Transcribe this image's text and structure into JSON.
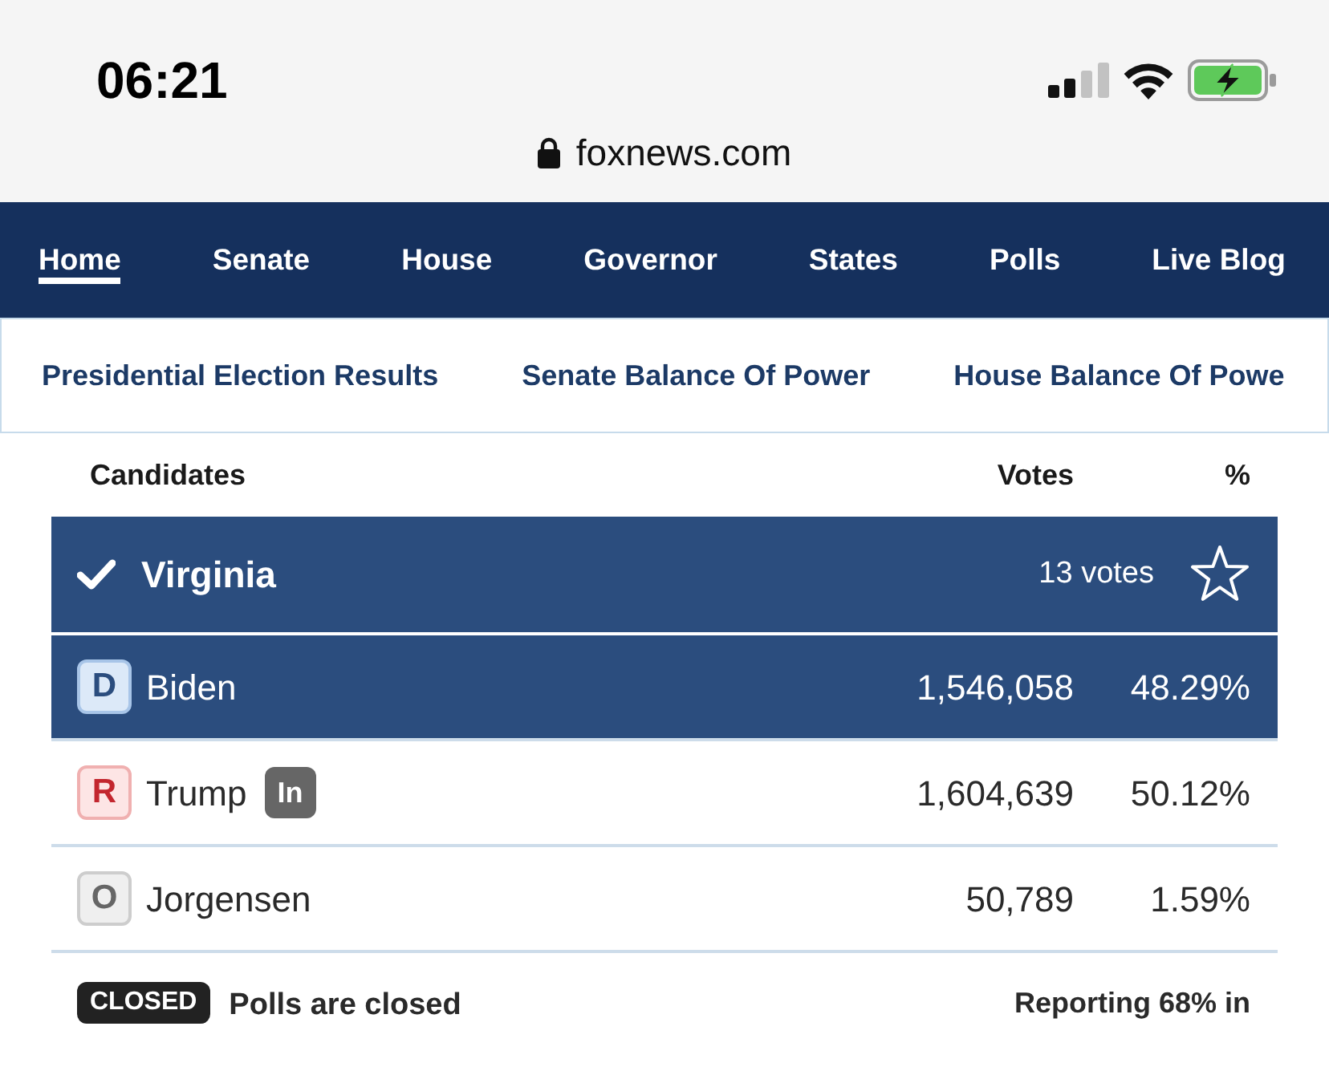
{
  "status_bar": {
    "time": "06:21"
  },
  "address_bar": {
    "url": "foxnews.com"
  },
  "nav_tabs": [
    {
      "label": "Home",
      "selected": true
    },
    {
      "label": "Senate",
      "selected": false
    },
    {
      "label": "House",
      "selected": false
    },
    {
      "label": "Governor",
      "selected": false
    },
    {
      "label": "States",
      "selected": false
    },
    {
      "label": "Polls",
      "selected": false
    },
    {
      "label": "Live Blog",
      "selected": false
    }
  ],
  "sub_nav": [
    "Presidential Election Results",
    "Senate Balance Of Power",
    "House Balance Of Powe"
  ],
  "table": {
    "columns": [
      "Candidates",
      "Votes",
      "%"
    ],
    "state": {
      "name": "Virginia",
      "called": true,
      "electoral_votes": "13 votes",
      "starred": false
    },
    "rows": [
      {
        "party": "D",
        "kind": "democrat",
        "name": "Biden",
        "votes": "1,546,058",
        "percent": "48.29%",
        "winner": true
      },
      {
        "party": "R",
        "kind": "republican",
        "name": "Trump",
        "tag": "In",
        "votes": "1,604,639",
        "percent": "50.12%",
        "winner": false
      },
      {
        "party": "O",
        "kind": "other",
        "name": "Jorgensen",
        "votes": "50,789",
        "percent": "1.59%",
        "winner": false
      }
    ]
  },
  "footer": {
    "status": "CLOSED",
    "message": "Polls are closed",
    "reporting": "Reporting 68% in"
  }
}
